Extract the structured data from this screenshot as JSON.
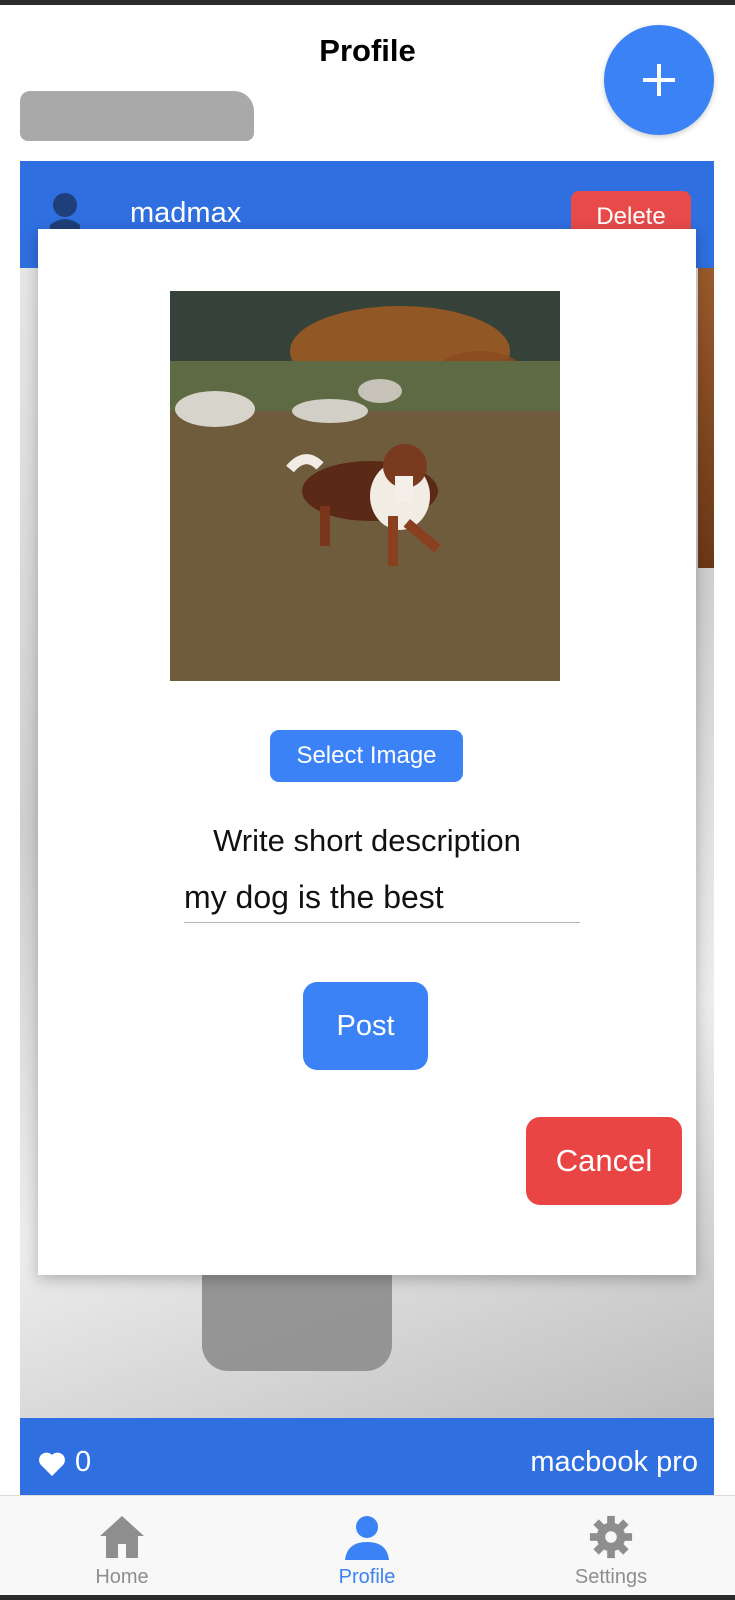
{
  "header": {
    "title": "Profile",
    "fab_label": "+"
  },
  "post": {
    "username": "madmax",
    "delete_label": "Delete",
    "like_count": "0",
    "caption": "macbook pro"
  },
  "modal": {
    "select_image_label": "Select Image",
    "description_label": "Write short description",
    "description_value": "my dog is the best",
    "post_label": "Post",
    "cancel_label": "Cancel"
  },
  "tabs": [
    {
      "label": "Home",
      "icon": "home-icon"
    },
    {
      "label": "Profile",
      "icon": "person-icon"
    },
    {
      "label": "Settings",
      "icon": "gear-icon"
    }
  ],
  "colors": {
    "accent": "#3b82f6",
    "header_blue": "#2f6fe0",
    "danger": "#ea4545"
  }
}
